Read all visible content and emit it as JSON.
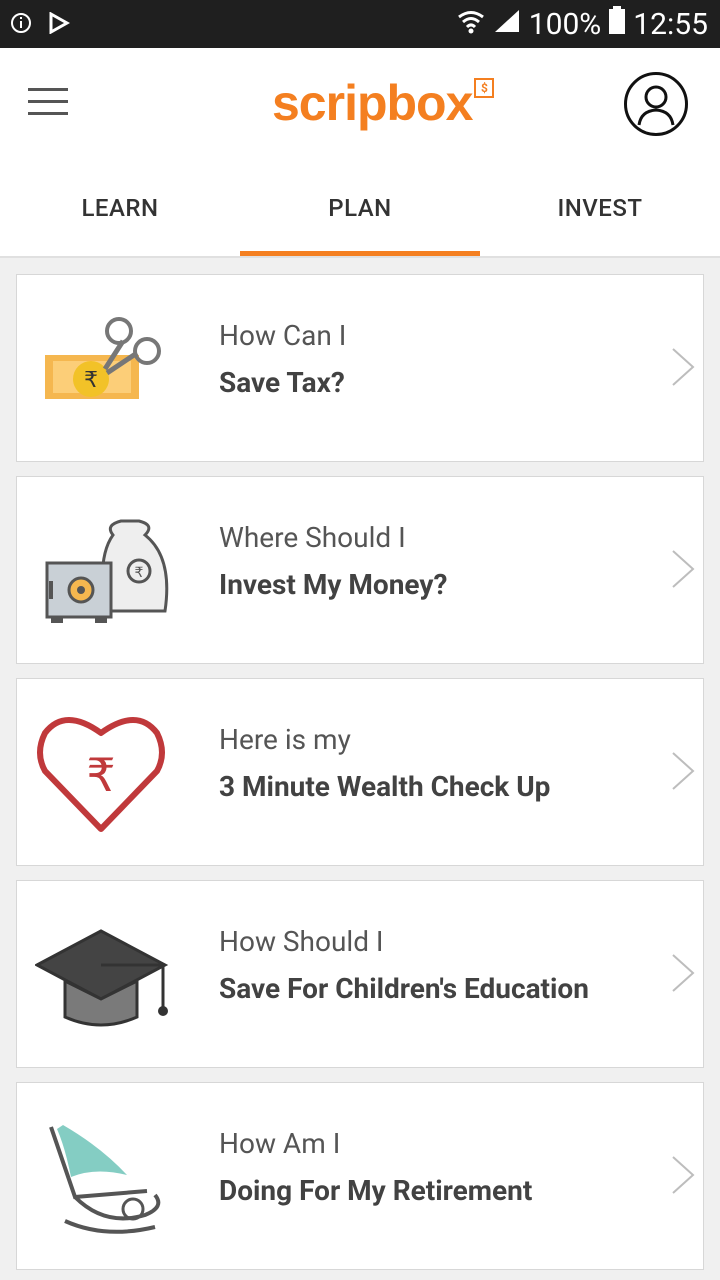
{
  "status_bar": {
    "battery": "100%",
    "time": "12:55"
  },
  "header": {
    "logo": "scripbox",
    "logo_badge": "$"
  },
  "tabs": [
    {
      "label": "LEARN",
      "active": false
    },
    {
      "label": "PLAN",
      "active": true
    },
    {
      "label": "INVEST",
      "active": false
    }
  ],
  "cards": [
    {
      "line1": "How Can I",
      "line2": "Save Tax?",
      "icon": "tax-cut-icon"
    },
    {
      "line1": "Where Should I",
      "line2": "Invest My Money?",
      "icon": "safe-moneybag-icon"
    },
    {
      "line1": "Here is my",
      "line2": "3 Minute Wealth Check Up",
      "icon": "rupee-heart-icon"
    },
    {
      "line1": "How Should I",
      "line2": "Save For Children's Education",
      "icon": "graduation-cap-icon"
    },
    {
      "line1": "How Am I",
      "line2": "Doing For My Retirement",
      "icon": "rocking-chair-icon"
    }
  ],
  "colors": {
    "accent": "#f47f20",
    "status_bar": "#1f1f1f"
  }
}
